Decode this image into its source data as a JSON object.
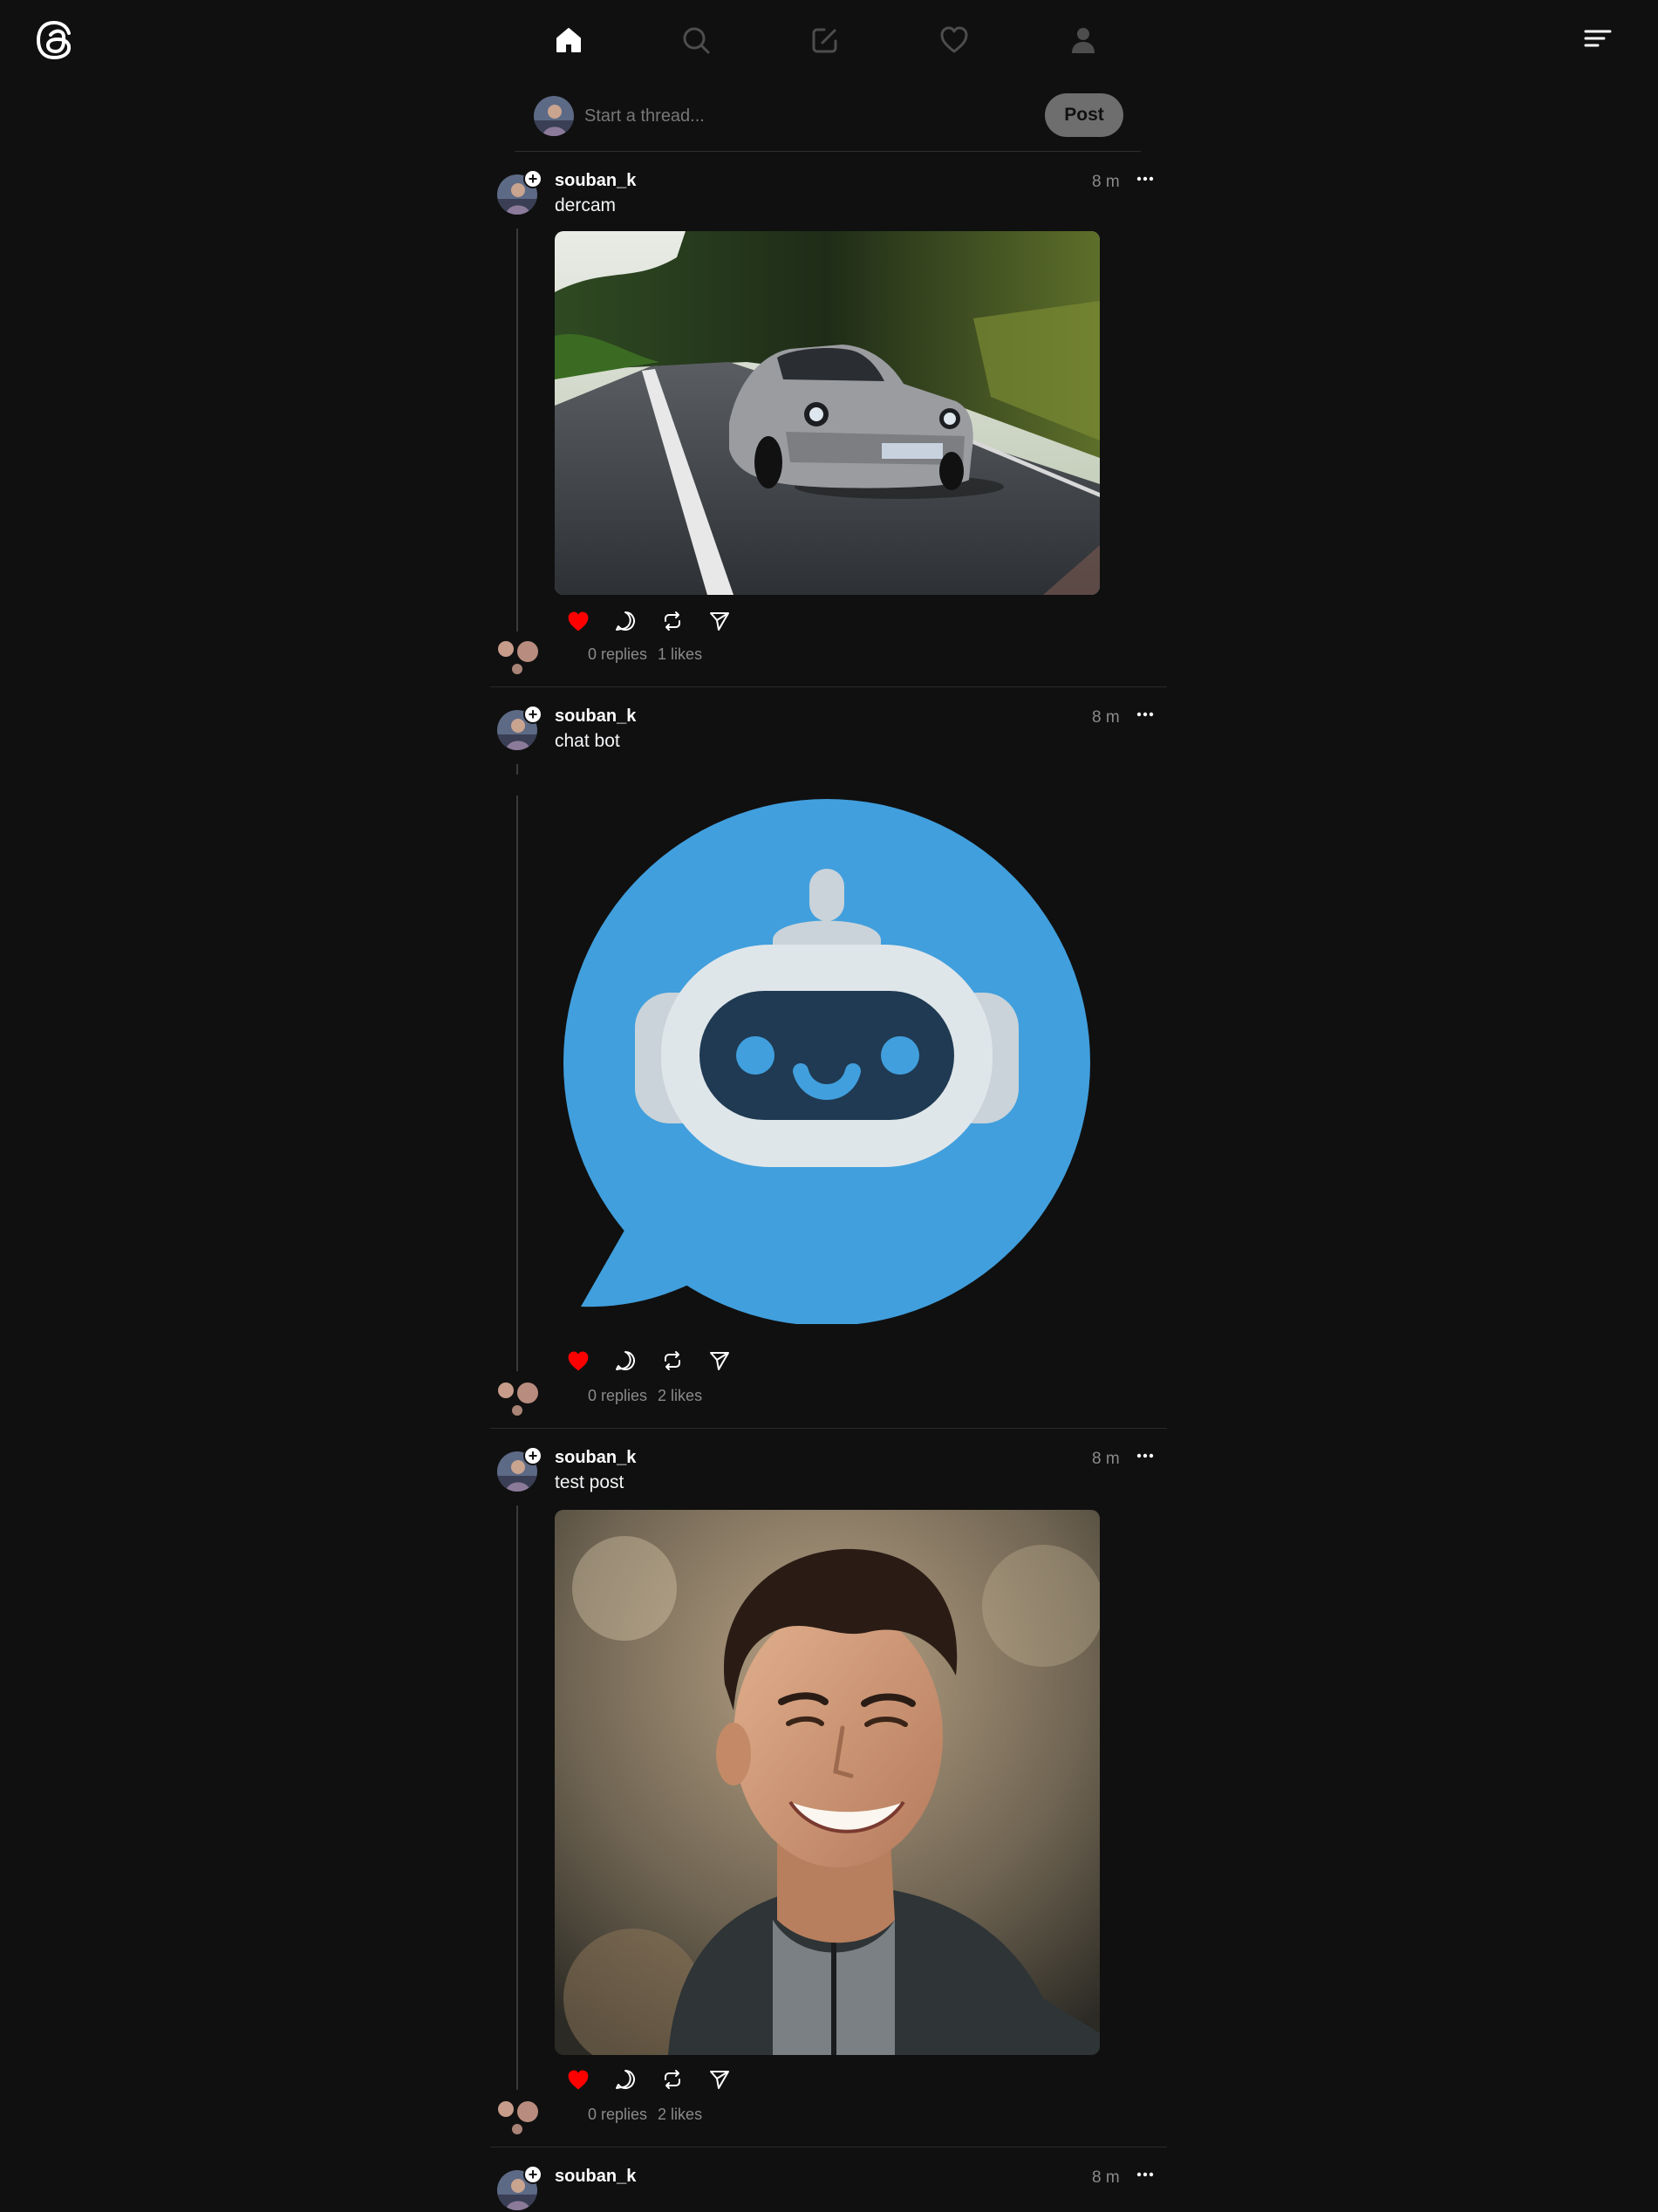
{
  "nav": {
    "items": [
      {
        "name": "home",
        "icon": "home-icon",
        "active": true
      },
      {
        "name": "search",
        "icon": "search-icon"
      },
      {
        "name": "create",
        "icon": "compose-icon"
      },
      {
        "name": "activity",
        "icon": "heart-icon"
      },
      {
        "name": "profile",
        "icon": "user-icon"
      }
    ]
  },
  "composer": {
    "placeholder": "Start a thread...",
    "post_label": "Post"
  },
  "posts": [
    {
      "username": "souban_k",
      "text": "dercam",
      "time": "8 m",
      "replies": "0 replies",
      "likes": "1 likes",
      "liked": true,
      "media": "car-photo"
    },
    {
      "username": "souban_k",
      "text": "chat bot",
      "time": "8 m",
      "replies": "0 replies",
      "likes": "2 likes",
      "liked": true,
      "media": "chatbot-illustration"
    },
    {
      "username": "souban_k",
      "text": "test post",
      "time": "8 m",
      "replies": "0 replies",
      "likes": "2 likes",
      "liked": true,
      "media": "portrait-photo"
    },
    {
      "username": "souban_k",
      "time": "8 m"
    }
  ],
  "colors": {
    "background": "#101010",
    "like_red": "#ff0000",
    "chatbot_blue": "#419fdd",
    "muted_text": "#8a8a8a"
  }
}
